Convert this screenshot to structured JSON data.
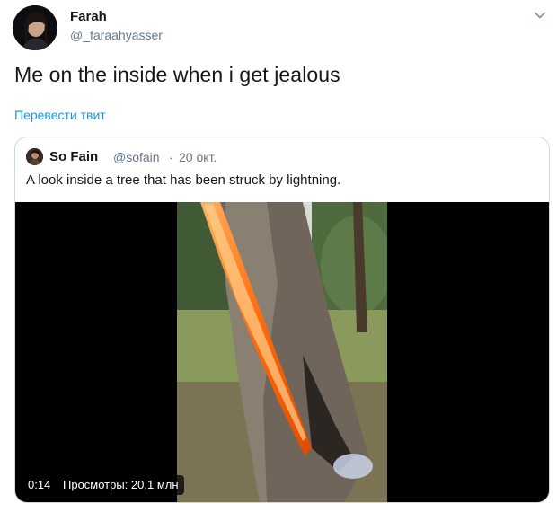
{
  "tweet": {
    "author": {
      "display_name": "Farah",
      "handle": "@_faraahyasser"
    },
    "text": "Me on the inside when i get jealous",
    "translate_label": "Перевести твит",
    "menu_icon": "chevron-down-icon"
  },
  "quoted_tweet": {
    "author": {
      "display_name": "So Fain",
      "handle": "@sofain"
    },
    "separator": "·",
    "date": "20 окт.",
    "text": "A look inside a tree that has been struck by lightning.",
    "video": {
      "duration": "0:14",
      "views": "Просмотры: 20,1 млн"
    }
  },
  "colors": {
    "link": "#1b95e0",
    "secondary_text": "#657786",
    "border": "#ccd6dd",
    "primary_text": "#14171a"
  }
}
